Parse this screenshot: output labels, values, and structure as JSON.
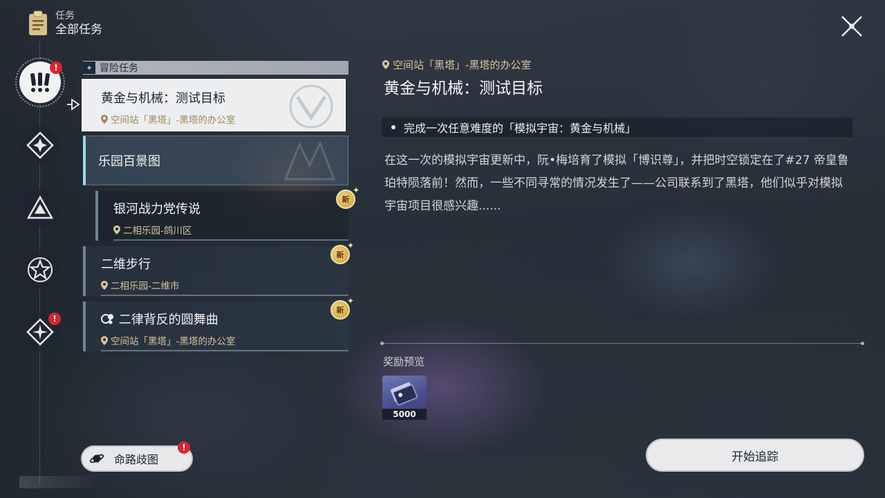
{
  "header": {
    "subtitle": "任务",
    "title": "全部任务"
  },
  "nav": {
    "items": [
      {
        "name": "adventure",
        "badge": "!"
      },
      {
        "name": "companion"
      },
      {
        "name": "daily"
      },
      {
        "name": "trailblaze"
      },
      {
        "name": "event",
        "badge": "!"
      }
    ]
  },
  "category": {
    "label": "冒险任务"
  },
  "quests": {
    "selected": {
      "title": "黄金与机械：测试目标",
      "location": "空间站「黑塔」-黑塔的办公室"
    },
    "group": {
      "title": "乐园百景图"
    },
    "sub": {
      "title": "银河战力党传说",
      "location": "二相乐园-鸽川区",
      "badge": "新"
    },
    "q2": {
      "title": "二维步行",
      "location": "二相乐园-二维市",
      "badge": "新"
    },
    "q3": {
      "title": "二律背反的圆舞曲",
      "location": "空间站「黑塔」-黑塔的办公室",
      "badge": "新"
    }
  },
  "route_button": {
    "label": "命路歧图",
    "badge": "!"
  },
  "detail": {
    "location": "空间站「黑塔」-黑塔的办公室",
    "title": "黄金与机械：测试目标",
    "objective": "完成一次任意难度的「模拟宇宙：黄金与机械」",
    "description": "在这一次的模拟宇宙更新中，阮•梅培育了模拟「博识尊」，并把时空锁定在了#27 帝皇鲁珀特陨落前！然而，一些不同寻常的情况发生了——公司联系到了黑塔，他们似乎对模拟宇宙项目很感兴趣......",
    "reward_label": "奖励预览",
    "reward_count": "5000",
    "track_label": "开始追踪"
  },
  "colors": {
    "accent_cyan": "#9ad8ea",
    "location_gold": "#d8c49a",
    "badge_red": "#d8262e"
  }
}
